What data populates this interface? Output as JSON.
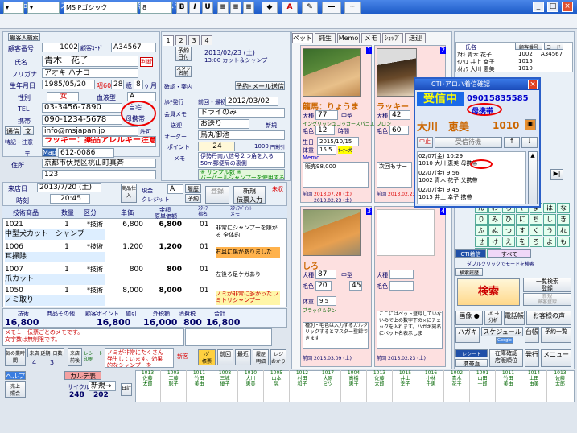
{
  "window": {
    "title": "Pro.21シリーズ　－[ ペットサロン顧客管理システム ]"
  },
  "toolbar": {
    "font": "MS Pゴシック",
    "size": "8",
    "bold": "B",
    "italic": "I",
    "underline": "U"
  },
  "customer": {
    "section_label": "顧客人検索",
    "customer_no_label": "顧客番号",
    "customer_no": "1002",
    "code_label": "顧客ｺｰﾄﾞ",
    "code": "A34567",
    "name_label": "氏名",
    "name": "青木　花子",
    "kana_label": "フリガナ",
    "kana": "アオキ ハナコ",
    "birth_label": "生年月日",
    "birth": "1985/05/20",
    "era": "昭60",
    "age": "28",
    "age_unit": "歳",
    "month": "8",
    "month_unit": "ヶ月",
    "gender_label": "性別",
    "gender": "女",
    "blood_label": "血液型",
    "blood": "A",
    "tel_label": "TEL",
    "tel": "03-3456-7890",
    "tel_type": "自宅",
    "mobile_label": "携帯",
    "mobile": "090-1234-5678",
    "mobile_type": "母携帯",
    "comm_label": "通信",
    "mail_label": "文",
    "email": "info@msjapan.jp",
    "permit_label": "許可",
    "note_label": "特記・注意",
    "note": "ラッキー：薬品アレルギー注意",
    "zip_label": "〒",
    "map_label": "Map",
    "zip": "612-0086",
    "addr_label": "住所",
    "addr1": "京都市伏見区桃山町真斉",
    "addr2": "123",
    "dm_label": "DM",
    "card_label": "顧客"
  },
  "visit": {
    "tabs": [
      "1",
      "2",
      "3",
      "4"
    ],
    "reserve_btn": "予約\n日付",
    "reserve_date": "2013/02/23 (土)",
    "reserve_time": "13:00 カット＆シャンプー",
    "staff_btn": "スタッフ\n名前",
    "confirm_label": "確認・案内",
    "mail_reserve": "予約･メール送信",
    "card_issue_label": "ｶﾙﾃ発行",
    "first_label": "前回・最初",
    "first_date": "2012/03/02",
    "rec_label": "会員メモ",
    "rec_value": "ドライのみ",
    "send_label": "送迎",
    "send_value": "お送り",
    "new_label": "新規",
    "order_label": "オーダー",
    "order_value": "烏丸御池",
    "point_label": "ポイント",
    "point_value": "24",
    "point_amount": "1000",
    "point_unit": "円割引",
    "memo_label": "メモ",
    "memo_text": "伊勢丹南八信号２つ角を入る50m郵便局の裏側",
    "sample_text": "※ サンプル数 ※\nバーバールシャンプーを使用する"
  },
  "slip": {
    "date_label": "来店日",
    "date": "2013/7/20 (土)",
    "time_label": "時刻",
    "time": "20:45",
    "coupon_label": "商品仕入",
    "cash_label": "現金",
    "credit_label": "クレジット",
    "staff_label": "A",
    "history_label": "履歴",
    "reserve2_label": "予約",
    "register_btn": "登録",
    "new_slip_btn": "新規\n伝票入力",
    "unfinished": "未収",
    "header": {
      "item": "技術商品",
      "qty": "数量",
      "class": "区分",
      "price": "単価",
      "amount": "金額",
      "cost": "原単価額",
      "staff": "ｽﾀｯﾌ\n指名",
      "memo": "ｽﾀｯﾌﾎﾟｲﾝﾄ\nメモ"
    },
    "rows": [
      {
        "code": "1021",
        "name": "中型犬カット＋シャンプー",
        "qty": "1",
        "class": "*技術",
        "price": "6,800",
        "amount": "6,800",
        "staff": "01",
        "memo": "非常にシャンプーを嫌がる 全体的"
      },
      {
        "code": "1006",
        "name": "耳掃除",
        "qty": "1",
        "class": "*技術",
        "price": "1,200",
        "amount": "1,200",
        "staff": "01",
        "memo": "右耳に傷がありました"
      },
      {
        "code": "1007",
        "name": "爪カット",
        "qty": "1",
        "class": "*技術",
        "price": "800",
        "amount": "800",
        "staff": "01",
        "memo": "左後ろ足ケガあり"
      },
      {
        "code": "1050",
        "name": "ノミ取り",
        "qty": "1",
        "class": "*技術",
        "price": "8,000",
        "amount": "8,000",
        "staff": "01",
        "memo": "ノミが非常に多かった ノミトリシャンプー"
      }
    ],
    "totals_header": {
      "tech": "技術",
      "product": "商品その他",
      "tax": "税込合計",
      "point": "顧客ポイント",
      "discount": "値引",
      "tax2": "外税額",
      "consume": "消費税",
      "total": "合計"
    },
    "totals": {
      "tech": "16,800",
      "discount": "16",
      "sum": "16,800",
      "tax": "16,000",
      "zero": "800",
      "total": "16,800"
    },
    "memo_notice": "メモ１　伝票ごとのメモです。\n文字数は無制限です。",
    "reminder": "ノミが非常にたくさん\n発生しています。効果\n的なシャンプーを"
  },
  "bottom": {
    "fire_label": "気の業時間",
    "visit_btn": "来店 延期･日数",
    "count1": "4",
    "count2": "3",
    "next_btn": "来店\n前後",
    "receipt_label": "レシート\n印刷",
    "new_btn": "新客",
    "cash_btn": "ﾚｼﾞ\n帳票",
    "prev_btn": "前回",
    "latest_btn": "最近",
    "history_btn": "履歴\n明細",
    "reg_btn": "レジ\nおかり",
    "help_btn": "ヘルプ",
    "karte_btn": "カルテ表",
    "sales_btn": "売上\n照会",
    "cycle_label": "サイクル",
    "cycle_value": "新規→",
    "num1": "248",
    "num2": "202",
    "daily": "日計"
  },
  "pets": {
    "tabs": [
      "ペット",
      "鈍生",
      "Memo",
      "メモ",
      "ｼｮｯﾌﾟ",
      "送迎"
    ],
    "cards": [
      {
        "no": "1",
        "name": "龍馬：りょうま",
        "breed_label": "犬種",
        "breed": "77",
        "size": "中型",
        "breed_name": "イングリッシュコッカースパニエル",
        "color_label": "毛色",
        "color": "12",
        "time": "時間",
        "sex_label": "雄",
        "birth_label": "生日",
        "birth": "2015/10/15",
        "weight_label": "体重",
        "weight": "15.5",
        "type": "ｵｰﾅｰ犬",
        "memo_label": "Memo",
        "memo": "販売98,000",
        "first_label": "前回",
        "first_date": "2013.07.20 (土)",
        "last_date": "2013.02.23 (土)"
      },
      {
        "no": "2",
        "name": "ラッキー",
        "breed_label": "犬種",
        "breed": "42",
        "breed_name": "プロン",
        "color_label": "毛色",
        "color": "60",
        "memo": "次回もサー",
        "first_label": "前回",
        "first_date": "2013.02.23 (土)"
      },
      {
        "no": "3",
        "name": "しろ",
        "breed_label": "犬種",
        "breed": "87",
        "size": "中型",
        "color_label": "毛色",
        "color": "20",
        "num": "45",
        "weight_label": "体重",
        "weight": "9.5",
        "color_name": "ブラック＆タン",
        "memo": "種別・毛色は入力するガルクリックするとマスター登録できます",
        "first_label": "前回",
        "first_date": "2013.03.09 (土)"
      },
      {
        "no": "4",
        "name": "",
        "breed_label": "犬種",
        "color_label": "毛色",
        "memo": "ここにはペット登録していないので上の数字下の×にチェックを入れます。ハガキ宛名にペット名表示しま",
        "first_label": "前回",
        "first_date": "2013.02.23 (土)"
      }
    ]
  },
  "popup": {
    "title": "CTI･アロハ着信確認",
    "status": "受信中",
    "number": "09015835585",
    "type": "母携帯",
    "name": "大川　恵美",
    "id": "1010",
    "mid_label": "中止",
    "wait_label": "受信待機",
    "log": [
      {
        "date": "02/07(金)",
        "time": "10:29",
        "id": "1010",
        "name": "大川 恵美",
        "type": "母携帯"
      },
      {
        "date": "02/07(金)",
        "time": "9:56",
        "id": "1002",
        "name": "青木 花子",
        "type": "父携帯"
      },
      {
        "date": "02/07(金)",
        "time": "9:45",
        "id": "1015",
        "name": "井上 幸子",
        "type": "携帯"
      }
    ]
  },
  "right": {
    "header": {
      "name": "氏名",
      "code": "顧客番号",
      "code2": "コード"
    },
    "list": [
      {
        "name": "ｱｵｷ 青木 花子",
        "no": "1002",
        "code": "A34567"
      },
      {
        "name": "ｲﾉｳｴ 井上 幸子",
        "no": "1015",
        "code": ""
      },
      {
        "name": "ｵｵｶﾜ 大川 恵美",
        "no": "1010",
        "code": ""
      }
    ],
    "kana": [
      "ん",
      "わ",
      "ら",
      "や",
      "ま",
      "は",
      "な",
      "た",
      "さ",
      "か",
      "あ",
      "り",
      "み",
      "ひ",
      "に",
      "ち",
      "し",
      "き",
      "い",
      "る",
      "ゆ",
      "む",
      "ふ",
      "ぬ",
      "つ",
      "す",
      "く",
      "う",
      "れ",
      "め",
      "へ",
      "ね",
      "て",
      "せ",
      "け",
      "え",
      "を",
      "ろ",
      "よ",
      "も",
      "ほ",
      "の",
      "と",
      "そ",
      "こ",
      "お"
    ],
    "cti_label": "CTI着信",
    "all_label": "すべて",
    "dbl_label": "ダブルクリックでモードを検索",
    "search_label": "検索履歴",
    "search_btn": "検索",
    "list_btn": "一覧検索\n登録",
    "new_btn": "新規\n顧客登録",
    "image_btn": "画像 ●",
    "report_btn": "ﾚﾎﾟｰﾄ\n分析",
    "tel_btn": "電話帳",
    "customer_btn": "お客様の声",
    "hagaki_btn": "ハガキ",
    "schedule_btn": "スケジュール",
    "google_btn": "Google",
    "list2_btn": "台帳",
    "reserve_btn": "予約一覧",
    "receipt_btn": "レシート",
    "stock_btn": "在庫確認\n店販順位",
    "menu_btn": "メニュー",
    "issue_btn": "発行",
    "contact_btn": "携帯直"
  },
  "bottombar": {
    "cells": [
      {
        "no": "1013",
        "n1": "佐藤",
        "n2": "太郎"
      },
      {
        "no": "1003",
        "n1": "工藤",
        "n2": "聡子"
      },
      {
        "no": "1011",
        "n1": "竹田",
        "n2": "美由"
      },
      {
        "no": "1008",
        "n1": "三城",
        "n2": "優子"
      },
      {
        "no": "1010",
        "n1": "大川",
        "n2": "恵美"
      },
      {
        "no": "1005",
        "n1": "山本",
        "n2": "晃"
      },
      {
        "no": "1012",
        "n1": "村田",
        "n2": "和子"
      },
      {
        "no": "1017",
        "n1": "大原",
        "n2": "ミツ"
      },
      {
        "no": "1004",
        "n1": "高橋",
        "n2": "恵子"
      },
      {
        "no": "1013",
        "n1": "佐藤",
        "n2": "太郎"
      },
      {
        "no": "1015",
        "n1": "井上",
        "n2": "幸子"
      },
      {
        "no": "1016",
        "n1": "小林",
        "n2": "千恵"
      },
      {
        "no": "1002",
        "n1": "青木",
        "n2": "花子"
      },
      {
        "no": "1001",
        "n1": "山田",
        "n2": "一郎"
      },
      {
        "no": "1011",
        "n1": "竹田",
        "n2": "美由"
      },
      {
        "no": "1014",
        "n1": "上田",
        "n2": "由美"
      },
      {
        "no": "1013",
        "n1": "佐藤",
        "n2": "太郎"
      }
    ]
  }
}
